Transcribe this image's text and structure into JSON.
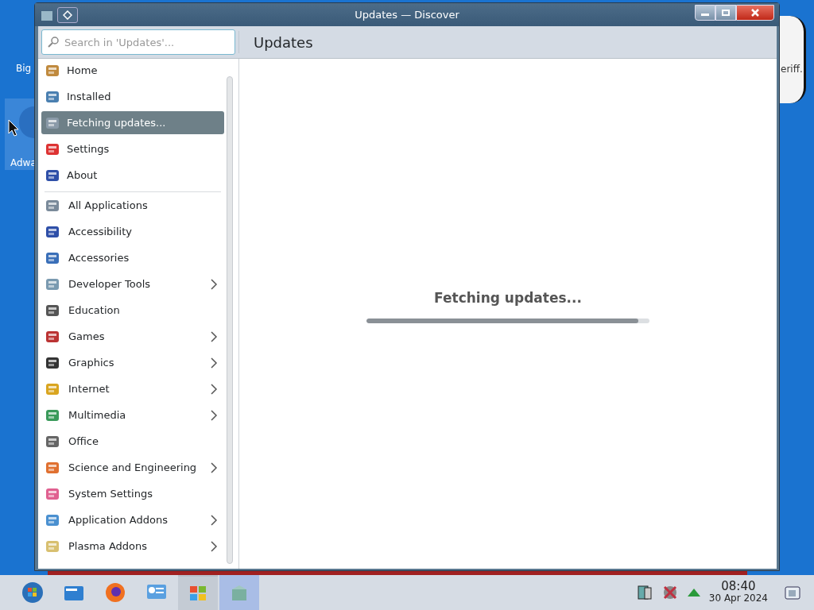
{
  "desktop": {
    "icons": [
      {
        "label": "Big"
      },
      {
        "label": "Adwa"
      },
      {
        "label": "eriff."
      }
    ]
  },
  "window": {
    "title": "Updates — Discover"
  },
  "search": {
    "placeholder": "Search in 'Updates'..."
  },
  "header": {
    "title": "Updates"
  },
  "sidebar": {
    "items": [
      {
        "label": "Home",
        "selected": false
      },
      {
        "label": "Installed",
        "selected": false
      },
      {
        "label": "Fetching updates...",
        "selected": true
      },
      {
        "label": "Settings",
        "selected": false
      },
      {
        "label": "About",
        "selected": false
      }
    ],
    "categories": [
      {
        "label": "All Applications",
        "expandable": false
      },
      {
        "label": "Accessibility",
        "expandable": false
      },
      {
        "label": "Accessories",
        "expandable": false
      },
      {
        "label": "Developer Tools",
        "expandable": true
      },
      {
        "label": "Education",
        "expandable": false
      },
      {
        "label": "Games",
        "expandable": true
      },
      {
        "label": "Graphics",
        "expandable": true
      },
      {
        "label": "Internet",
        "expandable": true
      },
      {
        "label": "Multimedia",
        "expandable": true
      },
      {
        "label": "Office",
        "expandable": false
      },
      {
        "label": "Science and Engineering",
        "expandable": true
      },
      {
        "label": "System Settings",
        "expandable": false
      },
      {
        "label": "Application Addons",
        "expandable": true
      },
      {
        "label": "Plasma Addons",
        "expandable": true
      }
    ]
  },
  "main": {
    "status": "Fetching updates...",
    "progress": {
      "level": 0.96
    }
  },
  "taskbar": {
    "items": [
      {
        "selected": false,
        "highlighted": false
      },
      {
        "selected": false,
        "highlighted": false
      },
      {
        "selected": false,
        "highlighted": false
      },
      {
        "selected": false,
        "highlighted": false
      },
      {
        "selected": false,
        "highlighted": true
      },
      {
        "selected": true,
        "highlighted": false
      }
    ]
  },
  "tray": {
    "time": "08:40",
    "date": "30 Apr 2024"
  }
}
